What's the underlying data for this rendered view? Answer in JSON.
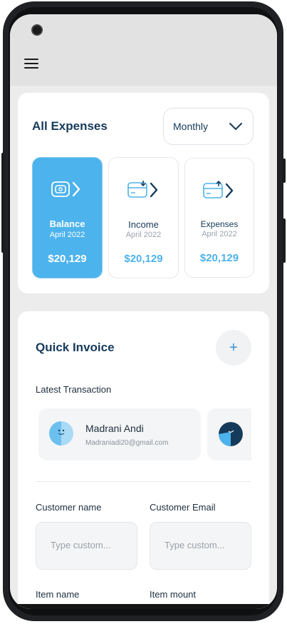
{
  "expenses": {
    "title": "All Expenses",
    "period": "Monthly",
    "tiles": [
      {
        "title": "Balance",
        "date": "April 2022",
        "value": "$20,129",
        "icon": "wallet-icon"
      },
      {
        "title": "Income",
        "date": "April 2022",
        "value": "$20,129",
        "icon": "card-download-icon"
      },
      {
        "title": "Expenses",
        "date": "April 2022",
        "value": "$20,129",
        "icon": "card-upload-icon"
      }
    ]
  },
  "invoice": {
    "title": "Quick Invoice",
    "add_label": "+",
    "latest_label": "Latest Transaction",
    "transactions": [
      {
        "name": "Madrani Andi",
        "email": "Madraniadi20@gmail.com"
      }
    ],
    "fields": {
      "customer_name_label": "Customer name",
      "customer_name_placeholder": "Type custom...",
      "customer_email_label": "Customer Email",
      "customer_email_placeholder": "Type custom...",
      "item_name_label": "Item name",
      "item_amount_label": "Item mount"
    }
  },
  "colors": {
    "accent": "#4db3ec",
    "navy": "#163a5a"
  }
}
